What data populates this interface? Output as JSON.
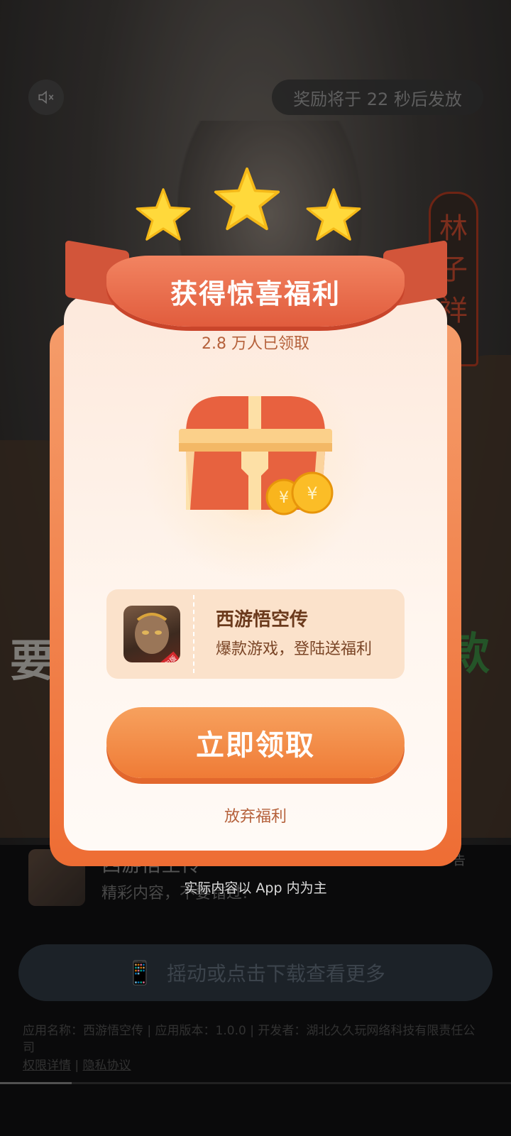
{
  "background_video": {
    "sign_text": "林子祥",
    "side_text_left": "要",
    "side_text_right": "款"
  },
  "top": {
    "mute_icon": "speaker-muted-icon",
    "timer_text": "奖励将于 22 秒后发放"
  },
  "popup": {
    "ribbon_title": "获得惊喜福利",
    "claimed_count": "2.8 万人已领取",
    "game_name": "西游悟空传",
    "game_desc": "爆款游戏，登陆送福利",
    "game_badge": "红包版",
    "claim_button": "立即领取",
    "give_up": "放弃福利",
    "star_count": 3
  },
  "note": "实际内容以 App 内为主",
  "ad": {
    "app_title": "西游悟空传",
    "app_desc": "精彩内容，不要错过!",
    "ad_label": "广告",
    "shake_button": "摇动或点击下载查看更多",
    "legal_text": "应用名称：西游悟空传 | 应用版本：1.0.0 | 开发者：湖北久久玩网络科技有限责任公司",
    "permissions_link": "权限详情",
    "privacy_link": "隐私协议",
    "progress": 0.14
  },
  "colors": {
    "accent_orange": "#ef7b36",
    "ribbon_red": "#e15c3d",
    "card_cream": "#fff6ef"
  }
}
